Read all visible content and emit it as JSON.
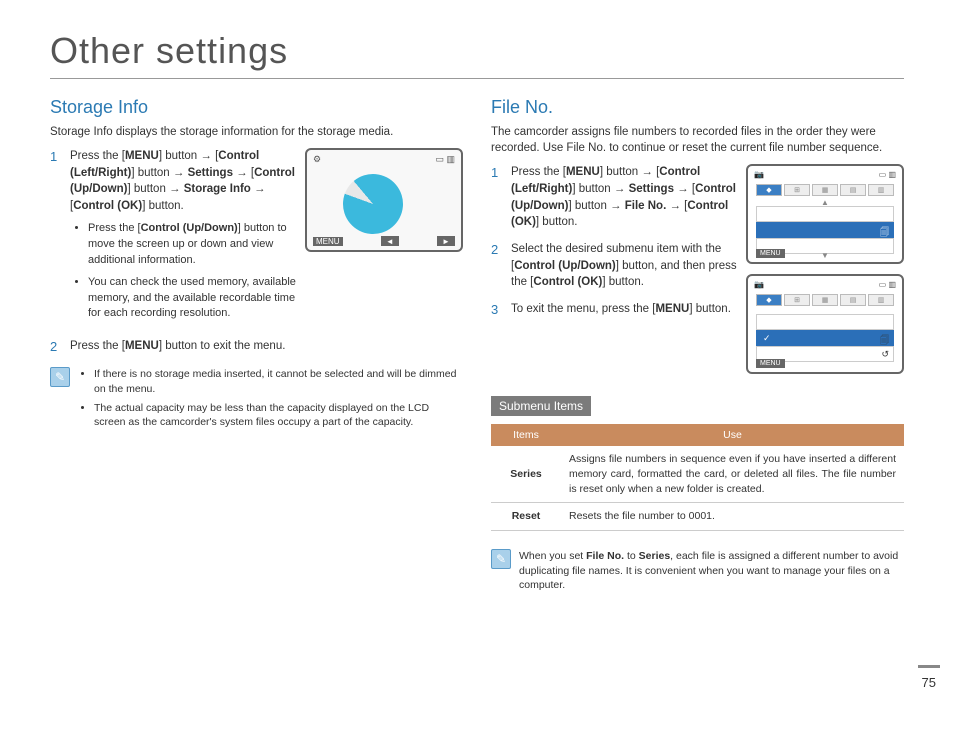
{
  "page_title": "Other settings",
  "page_number": "75",
  "left": {
    "heading": "Storage Info",
    "intro": "Storage Info displays the storage information for the storage media.",
    "step1_num": "1",
    "step1_a": "Press the [",
    "step1_menu": "MENU",
    "step1_b": "] button → [",
    "step1_ctrl_lr": "Control (Left/Right)",
    "step1_c": "] button → ",
    "step1_settings": "Settings",
    "step1_d": " → [",
    "step1_ctrl_ud": "Control (Up/Down)",
    "step1_e": "] button → ",
    "step1_storage": "Storage Info",
    "step1_f": " → [",
    "step1_ok": "Control (OK)",
    "step1_g": "] button.",
    "bullet1a": "Press the [",
    "bullet1a_ctrl": "Control (Up/Down)",
    "bullet1b": "] button to move the screen up or down and view additional information.",
    "bullet2": "You can check the used memory, available memory, and the available recordable time for each recording resolution.",
    "step2_num": "2",
    "step2_a": "Press the [",
    "step2_menu": "MENU",
    "step2_b": "] button to exit the menu.",
    "note1": "If there is no storage media inserted, it cannot be selected and will be dimmed on the menu.",
    "note2": "The actual capacity may be less than the capacity displayed on the LCD screen as the camcorder's system files occupy a part of the capacity.",
    "screen_menu": "MENU"
  },
  "right": {
    "heading": "File No.",
    "intro": "The camcorder assigns file numbers to recorded files in the order they were recorded. Use File No. to continue or reset the current file number sequence.",
    "step1_num": "1",
    "step1_a": "Press the [",
    "step1_menu": "MENU",
    "step1_b": "] button → [",
    "step1_ctrl_lr": "Control (Left/Right)",
    "step1_c": "] button → ",
    "step1_settings": "Settings",
    "step1_d": " → [",
    "step1_ctrl_ud": "Control (Up/Down)",
    "step1_e": "] button → ",
    "step1_fileno": "File No.",
    "step1_f": " → [",
    "step1_ok": "Control (OK)",
    "step1_g": "] button.",
    "step2_num": "2",
    "step2_a": "Select the desired submenu item with the [",
    "step2_ctrl": "Control (Up/Down)",
    "step2_b": "] button, and then press the [",
    "step2_ok": "Control (OK)",
    "step2_c": "] button.",
    "step3_num": "3",
    "step3_a": "To exit the menu, press the [",
    "step3_menu": "MENU",
    "step3_b": "] button.",
    "submenu_heading": "Submenu Items",
    "th_items": "Items",
    "th_use": "Use",
    "row1_item": "Series",
    "row1_use": "Assigns file numbers in sequence even if you have inserted a different memory card, formatted the card, or deleted all files. The file number is reset only when a new folder is created.",
    "row2_item": "Reset",
    "row2_use": "Resets the file number to 0001.",
    "note_a": "When you set ",
    "note_b": "File No.",
    "note_c": " to ",
    "note_d": "Series",
    "note_e": ", each file is assigned a different number to avoid duplicating file names. It is convenient when you want to manage your files on a computer.",
    "screen_menu": "MENU"
  }
}
